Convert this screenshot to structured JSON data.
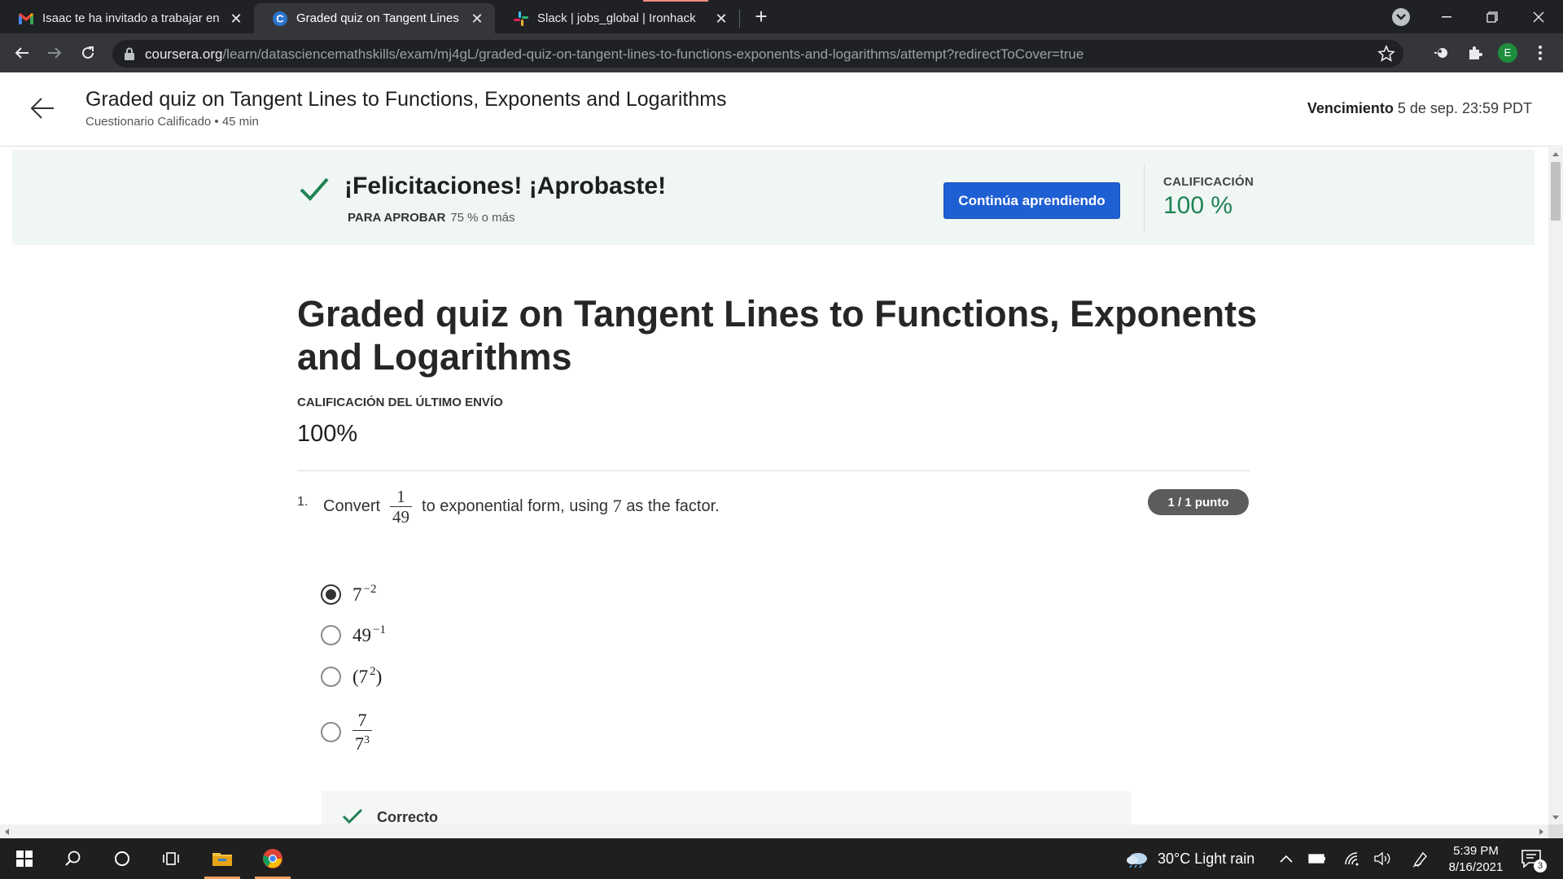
{
  "browser": {
    "tabs": [
      {
        "title": "Isaac te ha invitado a trabajar en",
        "icon": "gmail-icon",
        "active": false
      },
      {
        "title": "Graded quiz on Tangent Lines to",
        "icon": "coursera-icon",
        "active": true
      },
      {
        "title": "Slack | jobs_global | Ironhack",
        "icon": "slack-icon",
        "active": false
      }
    ],
    "url_host": "coursera.org",
    "url_path": "/learn/datasciencemathskills/exam/mj4gL/graded-quiz-on-tangent-lines-to-functions-exponents-and-logarithms/attempt?redirectToCover=true",
    "profile_initial": "E"
  },
  "header": {
    "title": "Graded quiz on Tangent Lines to Functions, Exponents and Logarithms",
    "subtitle": "Cuestionario Calificado • 45 min",
    "due_label": "Vencimiento",
    "due_value": "5 de sep. 23:59 PDT"
  },
  "banner": {
    "title": "¡Felicitaciones! ¡Aprobaste!",
    "pass_label": "PARA APROBAR",
    "pass_value": "75 % o más",
    "continue_label": "Continúa aprendiendo",
    "grade_label": "CALIFICACIÓN",
    "grade_value": "100 %",
    "accent_color": "#1f8354",
    "button_color": "#1f5fd4"
  },
  "quiz": {
    "title": "Graded quiz on Tangent Lines to Functions, Exponents and Logarithms",
    "last_grade_label": "CALIFICACIÓN DEL ÚLTIMO ENVÍO",
    "last_grade_value": "100%"
  },
  "question": {
    "number": "1.",
    "text_before": "Convert",
    "frac_num": "1",
    "frac_den": "49",
    "text_middle": "to exponential form, using",
    "factor": "7",
    "text_after": "as the factor.",
    "points": "1 / 1 punto",
    "options": [
      {
        "base": "7",
        "exp": "−2",
        "selected": true
      },
      {
        "base": "49",
        "exp": "−1",
        "selected": false
      },
      {
        "prefix": "(7",
        "exp": "2",
        "suffix": ")",
        "selected": false
      },
      {
        "frac_num": "7",
        "frac_den_base": "7",
        "frac_den_exp": "3",
        "selected": false
      }
    ],
    "feedback_label": "Correcto"
  },
  "taskbar": {
    "weather": "30°C  Light rain",
    "time": "5:39 PM",
    "date": "8/16/2021",
    "notification_count": "3"
  }
}
